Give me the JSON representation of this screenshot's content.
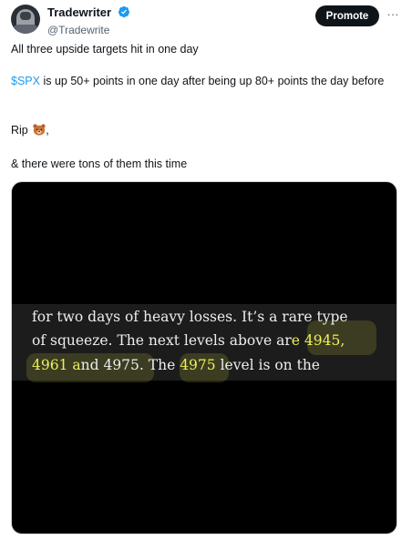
{
  "author": {
    "display_name": "Tradewriter",
    "handle": "@Tradewrite",
    "verified": true
  },
  "actions": {
    "promote_label": "Promote",
    "more_label": "···"
  },
  "tweet": {
    "line1": "All three upside targets hit in one day",
    "cashtag": "$SPX",
    "line2_rest": " is up 50+ points in one day after being up 80+ points the day before",
    "line3": "Rip",
    "line3_emoji": "bear-face-icon",
    "line3_suffix": ",",
    "line4": "& there were tons of them this time"
  },
  "media": {
    "caption_line1": "for two days of heavy losses. It’s a rare type",
    "caption_line2_a": "of squeeze. The next levels above ar",
    "caption_line2_b": "e 4945,",
    "caption_line3_a": "4961",
    "caption_line3_b": " a",
    "caption_line3_c": "nd 4975. The ",
    "caption_line3_d": "4975",
    "caption_line3_e": " level is on the",
    "highlight_color": "#eef05a",
    "background_color": "#000000"
  },
  "colors": {
    "link": "#1d9bf0",
    "text": "#0f1419",
    "secondary": "#536471",
    "verified_badge": "#1d9bf0"
  }
}
